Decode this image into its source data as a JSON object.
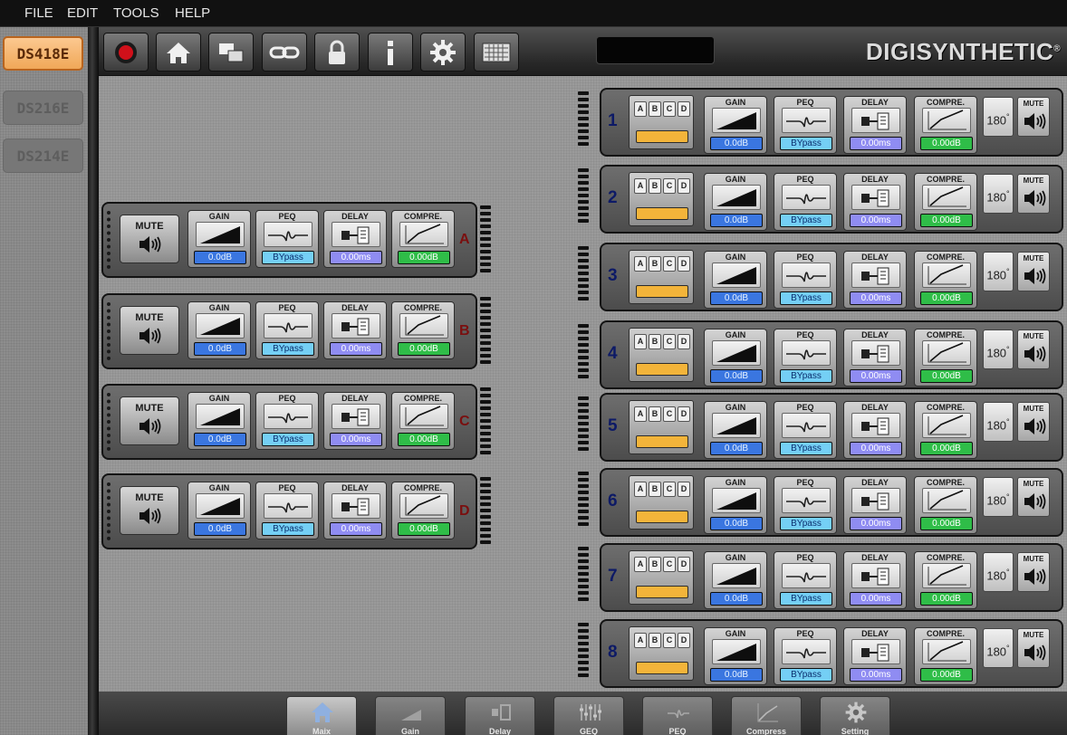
{
  "menu": [
    "FILE",
    "EDIT",
    "TOOLS",
    "HELP"
  ],
  "devices": [
    {
      "label": "DS418E",
      "active": true
    },
    {
      "label": "DS216E",
      "active": false
    },
    {
      "label": "DS214E",
      "active": false
    }
  ],
  "toolbar": {
    "icons": [
      "record-icon",
      "home-icon",
      "copy-icon",
      "link-icon",
      "lock-icon",
      "info-icon",
      "gear-icon",
      "keyboard-icon"
    ],
    "display_value": ""
  },
  "logo": "DIGISYNTHETIC",
  "logo_mark": "®",
  "labels": {
    "mute": "MUTE",
    "gain": "GAIN",
    "peq": "PEQ",
    "delay": "DELAY",
    "compress": "COMPRE.",
    "phase": "180",
    "phase_unit": "°",
    "abcd": [
      "A",
      "B",
      "C",
      "D"
    ]
  },
  "inputs": [
    {
      "id": "A",
      "gain": "0.0dB",
      "peq": "BYpass",
      "delay": "0.00ms",
      "comp": "0.00dB"
    },
    {
      "id": "B",
      "gain": "0.0dB",
      "peq": "BYpass",
      "delay": "0.00ms",
      "comp": "0.00dB"
    },
    {
      "id": "C",
      "gain": "0.0dB",
      "peq": "BYpass",
      "delay": "0.00ms",
      "comp": "0.00dB"
    },
    {
      "id": "D",
      "gain": "0.0dB",
      "peq": "BYpass",
      "delay": "0.00ms",
      "comp": "0.00dB"
    }
  ],
  "outputs": [
    {
      "id": "1",
      "gain": "0.0dB",
      "peq": "BYpass",
      "delay": "0.00ms",
      "comp": "0.00dB"
    },
    {
      "id": "2",
      "gain": "0.0dB",
      "peq": "BYpass",
      "delay": "0.00ms",
      "comp": "0.00dB"
    },
    {
      "id": "3",
      "gain": "0.0dB",
      "peq": "BYpass",
      "delay": "0.00ms",
      "comp": "0.00dB"
    },
    {
      "id": "4",
      "gain": "0.0dB",
      "peq": "BYpass",
      "delay": "0.00ms",
      "comp": "0.00dB"
    },
    {
      "id": "5",
      "gain": "0.0dB",
      "peq": "BYpass",
      "delay": "0.00ms",
      "comp": "0.00dB"
    },
    {
      "id": "6",
      "gain": "0.0dB",
      "peq": "BYpass",
      "delay": "0.00ms",
      "comp": "0.00dB"
    },
    {
      "id": "7",
      "gain": "0.0dB",
      "peq": "BYpass",
      "delay": "0.00ms",
      "comp": "0.00dB"
    },
    {
      "id": "8",
      "gain": "0.0dB",
      "peq": "BYpass",
      "delay": "0.00ms",
      "comp": "0.00dB"
    }
  ],
  "bottom_tabs": [
    {
      "label": "Maix",
      "icon": "home-icon",
      "active": true
    },
    {
      "label": "Gain",
      "icon": "gain-icon",
      "active": false
    },
    {
      "label": "Delay",
      "icon": "delay-icon",
      "active": false
    },
    {
      "label": "GEQ",
      "icon": "geq-icon",
      "active": false
    },
    {
      "label": "PEQ",
      "icon": "peq-icon",
      "active": false
    },
    {
      "label": "Compress",
      "icon": "compress-icon",
      "active": false
    },
    {
      "label": "Setting",
      "icon": "gear-icon",
      "active": false
    }
  ],
  "colors": {
    "active_device": "#f0a858",
    "gain_value": "#3a76e0",
    "peq_value": "#74cff5",
    "delay_value": "#8f8cf2",
    "comp_value": "#2fbd48",
    "preset_bar": "#f3b43a"
  }
}
